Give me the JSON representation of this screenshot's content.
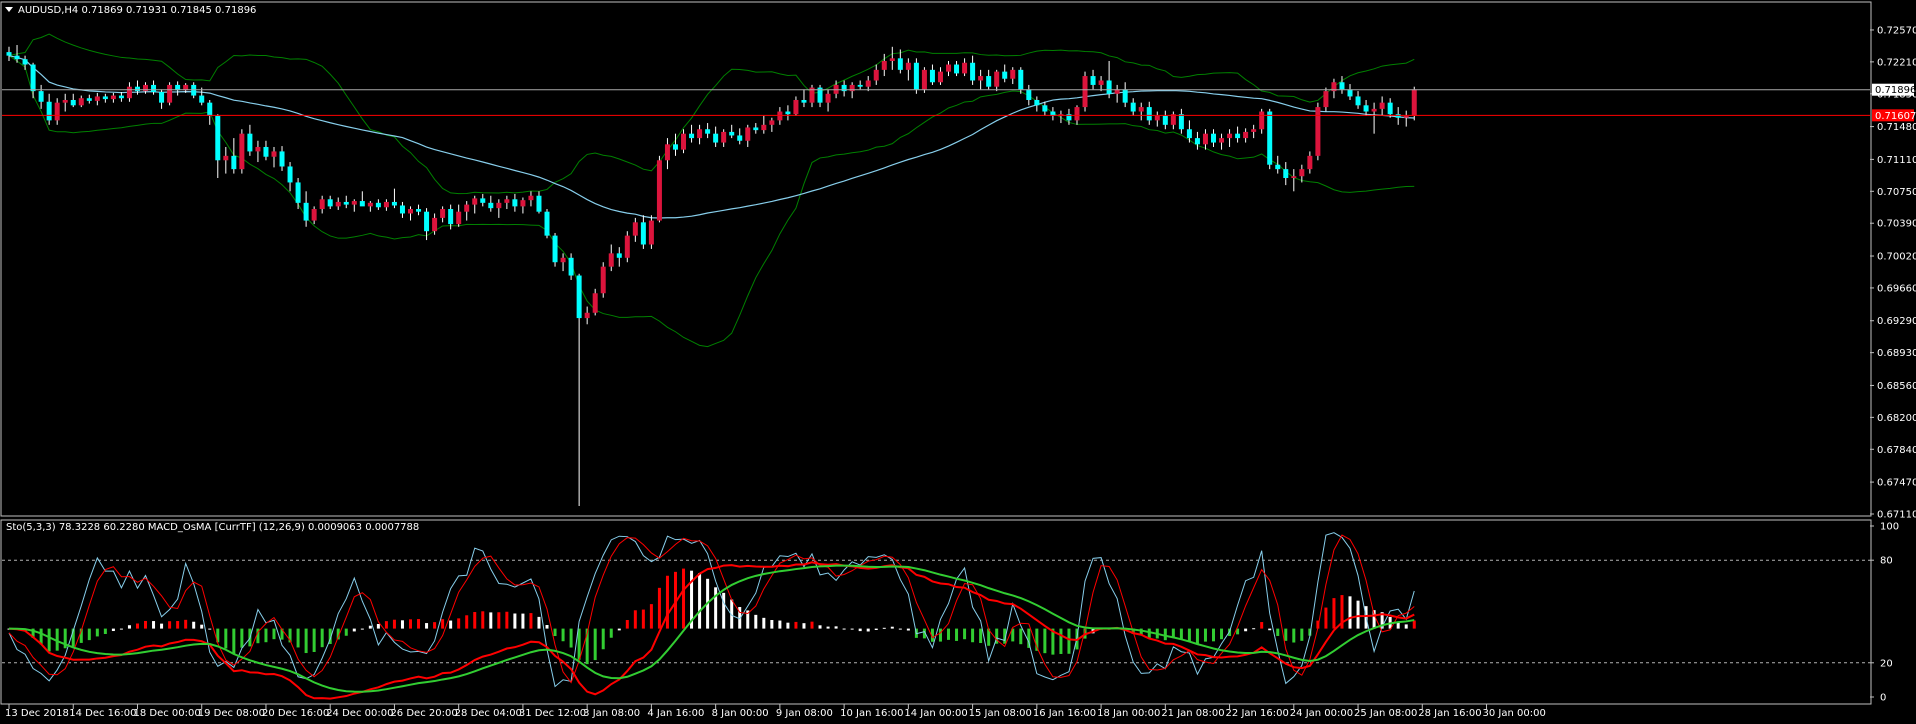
{
  "window": {
    "title": "AUDUSD,H4  0.71869 0.71931 0.71845 0.71896",
    "indicator_title": "Sto(5,3,3) 78.3228 60.2280  MACD_OsMA [CurrTF] (12,26,9) 0.0009063 0.0007788"
  },
  "colors": {
    "background": "#000000",
    "frame": "#c0c0c0",
    "grid": "#ffffff",
    "bull_candle": "#dc143c",
    "bear_candle": "#00ffff",
    "wick": "#ffffff",
    "bollinger": "#008000",
    "moving_average": "#87ceeb",
    "current_price_line": "#ff0000",
    "bid_line": "#a9a9a9",
    "bid_tag_bg": "#ffffff",
    "ask_tag_bg": "#ff0000",
    "osma_pos": "#ff0000",
    "osma_neg": "#32cd32",
    "osma_flat": "#ffffff",
    "stoch_main": "#87ceeb",
    "stoch_signal": "#ff0000",
    "macd_main": "#ff0000",
    "macd_signal": "#32cd32"
  },
  "chart_data": [
    {
      "type": "candlestick",
      "symbol": "AUDUSD",
      "timeframe": "H4",
      "ylim": [
        0.6711,
        0.7275
      ],
      "y_ticks": [
        "0.72570",
        "0.72210",
        "0.71850",
        "0.71480",
        "0.71110",
        "0.70750",
        "0.70390",
        "0.70020",
        "0.69660",
        "0.69290",
        "0.68930",
        "0.68560",
        "0.68200",
        "0.67840",
        "0.67470",
        "0.67110"
      ],
      "bid_price_tag": "0.71896",
      "ask_price_tag": "0.71607",
      "candles": [
        [
          0.7232,
          0.7238,
          0.7222,
          0.7228
        ],
        [
          0.7228,
          0.724,
          0.722,
          0.7224
        ],
        [
          0.7224,
          0.7228,
          0.7212,
          0.7218
        ],
        [
          0.7218,
          0.722,
          0.718,
          0.7188
        ],
        [
          0.7188,
          0.7195,
          0.7168,
          0.7176
        ],
        [
          0.7176,
          0.7185,
          0.715,
          0.7155
        ],
        [
          0.7155,
          0.718,
          0.715,
          0.7175
        ],
        [
          0.7175,
          0.7185,
          0.7165,
          0.7178
        ],
        [
          0.7178,
          0.7185,
          0.717,
          0.7172
        ],
        [
          0.7172,
          0.7183,
          0.717,
          0.718
        ],
        [
          0.718,
          0.7184,
          0.7174,
          0.7177
        ],
        [
          0.7177,
          0.7186,
          0.7172,
          0.7182
        ],
        [
          0.7182,
          0.7185,
          0.7175,
          0.7179
        ],
        [
          0.7179,
          0.7186,
          0.7175,
          0.7183
        ],
        [
          0.7183,
          0.7187,
          0.7176,
          0.718
        ],
        [
          0.718,
          0.7198,
          0.7176,
          0.7193
        ],
        [
          0.7193,
          0.72,
          0.7184,
          0.7188
        ],
        [
          0.7188,
          0.7198,
          0.7185,
          0.7195
        ],
        [
          0.7195,
          0.72,
          0.7184,
          0.7187
        ],
        [
          0.7187,
          0.719,
          0.7168,
          0.7175
        ],
        [
          0.7175,
          0.7198,
          0.7172,
          0.7195
        ],
        [
          0.7195,
          0.7199,
          0.7183,
          0.7189
        ],
        [
          0.7189,
          0.7197,
          0.7186,
          0.7195
        ],
        [
          0.7195,
          0.7198,
          0.718,
          0.7183
        ],
        [
          0.7183,
          0.7192,
          0.7172,
          0.7175
        ],
        [
          0.7175,
          0.7178,
          0.715,
          0.716
        ],
        [
          0.716,
          0.7162,
          0.709,
          0.711
        ],
        [
          0.711,
          0.7125,
          0.7095,
          0.7115
        ],
        [
          0.7115,
          0.7135,
          0.7095,
          0.71
        ],
        [
          0.71,
          0.7145,
          0.7095,
          0.714
        ],
        [
          0.714,
          0.715,
          0.7115,
          0.712
        ],
        [
          0.712,
          0.7132,
          0.7108,
          0.7125
        ],
        [
          0.7125,
          0.7132,
          0.711,
          0.7114
        ],
        [
          0.7114,
          0.7125,
          0.7102,
          0.712
        ],
        [
          0.712,
          0.7126,
          0.7098,
          0.7103
        ],
        [
          0.7103,
          0.7108,
          0.7075,
          0.7085
        ],
        [
          0.7085,
          0.709,
          0.7055,
          0.7062
        ],
        [
          0.7062,
          0.7075,
          0.7035,
          0.7042
        ],
        [
          0.7042,
          0.7058,
          0.7038,
          0.7055
        ],
        [
          0.7055,
          0.707,
          0.705,
          0.7066
        ],
        [
          0.7066,
          0.707,
          0.7055,
          0.7058
        ],
        [
          0.7058,
          0.7068,
          0.7054,
          0.7063
        ],
        [
          0.7063,
          0.707,
          0.7056,
          0.706
        ],
        [
          0.706,
          0.7066,
          0.7052,
          0.7064
        ],
        [
          0.7064,
          0.7075,
          0.706,
          0.7058
        ],
        [
          0.7058,
          0.7064,
          0.7052,
          0.7062
        ],
        [
          0.7062,
          0.7066,
          0.7054,
          0.7057
        ],
        [
          0.7057,
          0.7066,
          0.7053,
          0.7063
        ],
        [
          0.7063,
          0.7078,
          0.7056,
          0.7059
        ],
        [
          0.7059,
          0.7063,
          0.7045,
          0.705
        ],
        [
          0.705,
          0.7058,
          0.7042,
          0.7055
        ],
        [
          0.7055,
          0.706,
          0.7048,
          0.7052
        ],
        [
          0.7052,
          0.7056,
          0.702,
          0.703
        ],
        [
          0.703,
          0.705,
          0.7026,
          0.7045
        ],
        [
          0.7045,
          0.7058,
          0.704,
          0.7055
        ],
        [
          0.7055,
          0.706,
          0.7032,
          0.7038
        ],
        [
          0.7038,
          0.706,
          0.7035,
          0.7052
        ],
        [
          0.7052,
          0.7064,
          0.7042,
          0.706
        ],
        [
          0.706,
          0.707,
          0.705,
          0.7067
        ],
        [
          0.7067,
          0.7072,
          0.7058,
          0.7062
        ],
        [
          0.7062,
          0.707,
          0.7052,
          0.7056
        ],
        [
          0.7056,
          0.7066,
          0.7045,
          0.7062
        ],
        [
          0.7062,
          0.707,
          0.7055,
          0.7066
        ],
        [
          0.7066,
          0.7072,
          0.7052,
          0.7058
        ],
        [
          0.7058,
          0.7068,
          0.705,
          0.7065
        ],
        [
          0.7065,
          0.7075,
          0.7058,
          0.707
        ],
        [
          0.707,
          0.7075,
          0.705,
          0.7052
        ],
        [
          0.7052,
          0.7055,
          0.7022,
          0.7025
        ],
        [
          0.7025,
          0.7028,
          0.699,
          0.6995
        ],
        [
          0.6995,
          0.7005,
          0.6985,
          0.7
        ],
        [
          0.7,
          0.7005,
          0.6975,
          0.698
        ],
        [
          0.698,
          0.6982,
          0.672,
          0.6932
        ],
        [
          0.6932,
          0.6945,
          0.6925,
          0.6938
        ],
        [
          0.6938,
          0.6965,
          0.6935,
          0.696
        ],
        [
          0.696,
          0.6995,
          0.6955,
          0.699
        ],
        [
          0.699,
          0.7015,
          0.6985,
          0.7005
        ],
        [
          0.7005,
          0.7012,
          0.699,
          0.7
        ],
        [
          0.7,
          0.703,
          0.6995,
          0.7025
        ],
        [
          0.7025,
          0.7045,
          0.7018,
          0.704
        ],
        [
          0.704,
          0.7048,
          0.701,
          0.7015
        ],
        [
          0.7015,
          0.7048,
          0.701,
          0.7042
        ],
        [
          0.7042,
          0.7115,
          0.704,
          0.711
        ],
        [
          0.711,
          0.7135,
          0.71,
          0.7128
        ],
        [
          0.7128,
          0.714,
          0.7115,
          0.7122
        ],
        [
          0.7122,
          0.7145,
          0.7118,
          0.714
        ],
        [
          0.714,
          0.715,
          0.713,
          0.7135
        ],
        [
          0.7135,
          0.715,
          0.7128,
          0.7145
        ],
        [
          0.7145,
          0.7152,
          0.7135,
          0.714
        ],
        [
          0.714,
          0.7148,
          0.7125,
          0.713
        ],
        [
          0.713,
          0.7145,
          0.7125,
          0.7142
        ],
        [
          0.7142,
          0.715,
          0.7135,
          0.7138
        ],
        [
          0.7138,
          0.7146,
          0.7128,
          0.7132
        ],
        [
          0.7132,
          0.715,
          0.7125,
          0.7147
        ],
        [
          0.7147,
          0.7152,
          0.714,
          0.7144
        ],
        [
          0.7144,
          0.716,
          0.714,
          0.715
        ],
        [
          0.715,
          0.7158,
          0.7142,
          0.7155
        ],
        [
          0.7155,
          0.717,
          0.715,
          0.7165
        ],
        [
          0.7165,
          0.7172,
          0.7155,
          0.7162
        ],
        [
          0.7162,
          0.7182,
          0.716,
          0.7178
        ],
        [
          0.7178,
          0.719,
          0.717,
          0.7175
        ],
        [
          0.7175,
          0.7195,
          0.717,
          0.7192
        ],
        [
          0.7192,
          0.7195,
          0.717,
          0.7175
        ],
        [
          0.7175,
          0.719,
          0.7165,
          0.7185
        ],
        [
          0.7185,
          0.72,
          0.718,
          0.7195
        ],
        [
          0.7195,
          0.72,
          0.7182,
          0.7188
        ],
        [
          0.7188,
          0.7198,
          0.718,
          0.7195
        ],
        [
          0.7195,
          0.72,
          0.719,
          0.7193
        ],
        [
          0.7193,
          0.7205,
          0.7188,
          0.72
        ],
        [
          0.72,
          0.7218,
          0.7195,
          0.7212
        ],
        [
          0.7212,
          0.723,
          0.7205,
          0.7222
        ],
        [
          0.7222,
          0.7238,
          0.7212,
          0.7225
        ],
        [
          0.7225,
          0.7235,
          0.7208,
          0.7212
        ],
        [
          0.7212,
          0.7225,
          0.72,
          0.722
        ],
        [
          0.722,
          0.7225,
          0.7185,
          0.719
        ],
        [
          0.719,
          0.7215,
          0.7186,
          0.7212
        ],
        [
          0.7212,
          0.7218,
          0.7195,
          0.7198
        ],
        [
          0.7198,
          0.7215,
          0.7195,
          0.721
        ],
        [
          0.721,
          0.7222,
          0.7205,
          0.7218
        ],
        [
          0.7218,
          0.7222,
          0.7205,
          0.7208
        ],
        [
          0.7208,
          0.7225,
          0.7205,
          0.722
        ],
        [
          0.722,
          0.7228,
          0.7195,
          0.72
        ],
        [
          0.72,
          0.7212,
          0.719,
          0.7205
        ],
        [
          0.7205,
          0.7212,
          0.719,
          0.7193
        ],
        [
          0.7193,
          0.7212,
          0.7188,
          0.721
        ],
        [
          0.721,
          0.7218,
          0.7198,
          0.7202
        ],
        [
          0.7202,
          0.7215,
          0.7196,
          0.7212
        ],
        [
          0.7212,
          0.7215,
          0.7185,
          0.719
        ],
        [
          0.719,
          0.7195,
          0.7172,
          0.7178
        ],
        [
          0.7178,
          0.7182,
          0.7165,
          0.7172
        ],
        [
          0.7172,
          0.7176,
          0.716,
          0.7165
        ],
        [
          0.7165,
          0.717,
          0.7155,
          0.716
        ],
        [
          0.716,
          0.7166,
          0.7152,
          0.7162
        ],
        [
          0.7162,
          0.7168,
          0.715,
          0.7155
        ],
        [
          0.7155,
          0.7172,
          0.715,
          0.717
        ],
        [
          0.717,
          0.721,
          0.7165,
          0.7205
        ],
        [
          0.7205,
          0.7212,
          0.719,
          0.7195
        ],
        [
          0.7195,
          0.7205,
          0.7188,
          0.72
        ],
        [
          0.72,
          0.7222,
          0.718,
          0.7185
        ],
        [
          0.7185,
          0.7195,
          0.7175,
          0.719
        ],
        [
          0.719,
          0.7198,
          0.717,
          0.7175
        ],
        [
          0.7175,
          0.718,
          0.716,
          0.7165
        ],
        [
          0.7165,
          0.7175,
          0.7155,
          0.717
        ],
        [
          0.717,
          0.7176,
          0.715,
          0.7155
        ],
        [
          0.7155,
          0.7165,
          0.7148,
          0.716
        ],
        [
          0.716,
          0.7166,
          0.7145,
          0.715
        ],
        [
          0.715,
          0.7165,
          0.7145,
          0.7162
        ],
        [
          0.7162,
          0.7168,
          0.714,
          0.7145
        ],
        [
          0.7145,
          0.7155,
          0.713,
          0.7135
        ],
        [
          0.7135,
          0.7142,
          0.7122,
          0.7128
        ],
        [
          0.7128,
          0.7145,
          0.7122,
          0.714
        ],
        [
          0.714,
          0.7145,
          0.7125,
          0.713
        ],
        [
          0.713,
          0.714,
          0.7122,
          0.7135
        ],
        [
          0.7135,
          0.7145,
          0.7125,
          0.714
        ],
        [
          0.714,
          0.7148,
          0.713,
          0.7135
        ],
        [
          0.7135,
          0.7146,
          0.713,
          0.7142
        ],
        [
          0.7142,
          0.715,
          0.7135,
          0.7145
        ],
        [
          0.7145,
          0.7168,
          0.714,
          0.7165
        ],
        [
          0.7165,
          0.7168,
          0.71,
          0.7105
        ],
        [
          0.7105,
          0.7115,
          0.7095,
          0.71
        ],
        [
          0.71,
          0.7108,
          0.7082,
          0.709
        ],
        [
          0.709,
          0.71,
          0.7075,
          0.7092
        ],
        [
          0.7092,
          0.7105,
          0.7085,
          0.71
        ],
        [
          0.71,
          0.712,
          0.7095,
          0.7115
        ],
        [
          0.7115,
          0.7175,
          0.711,
          0.717
        ],
        [
          0.717,
          0.7192,
          0.7165,
          0.7188
        ],
        [
          0.7188,
          0.7202,
          0.718,
          0.7198
        ],
        [
          0.7198,
          0.7205,
          0.7185,
          0.719
        ],
        [
          0.719,
          0.7196,
          0.7178,
          0.7182
        ],
        [
          0.7182,
          0.7188,
          0.7168,
          0.7172
        ],
        [
          0.7172,
          0.7178,
          0.716,
          0.7165
        ],
        [
          0.7165,
          0.7175,
          0.714,
          0.7168
        ],
        [
          0.7168,
          0.7182,
          0.716,
          0.7175
        ],
        [
          0.7175,
          0.718,
          0.7158,
          0.7162
        ],
        [
          0.7162,
          0.717,
          0.715,
          0.7158
        ],
        [
          0.7158,
          0.7166,
          0.7148,
          0.716
        ],
        [
          0.716,
          0.7193,
          0.7155,
          0.719
        ]
      ],
      "x_labels": [
        "13 Dec 2018",
        "14 Dec 16:00",
        "18 Dec 00:00",
        "19 Dec 08:00",
        "20 Dec 16:00",
        "24 Dec 00:00",
        "26 Dec 20:00",
        "28 Dec 04:00",
        "31 Dec 12:00",
        "3 Jan 08:00",
        "4 Jan 16:00",
        "8 Jan 00:00",
        "9 Jan 08:00",
        "10 Jan 16:00",
        "14 Jan 00:00",
        "15 Jan 08:00",
        "16 Jan 16:00",
        "18 Jan 00:00",
        "21 Jan 08:00",
        "22 Jan 16:00",
        "24 Jan 00:00",
        "25 Jan 08:00",
        "28 Jan 16:00",
        "30 Jan 00:00"
      ],
      "x_label_candle_index": [
        0,
        8,
        16,
        24,
        32,
        40,
        48,
        56,
        64,
        72,
        80,
        88,
        96,
        104,
        112,
        120,
        128,
        136,
        144,
        152,
        160,
        168,
        176,
        184
      ]
    },
    {
      "type": "oscillator",
      "ylim": [
        0,
        100
      ],
      "y_ticks": [
        "100",
        "80",
        "20",
        "0"
      ],
      "levels": [
        80,
        20
      ],
      "series_names": [
        "Stochastic main",
        "Stochastic signal",
        "MACD main",
        "MACD signal",
        "OsMA"
      ]
    }
  ]
}
